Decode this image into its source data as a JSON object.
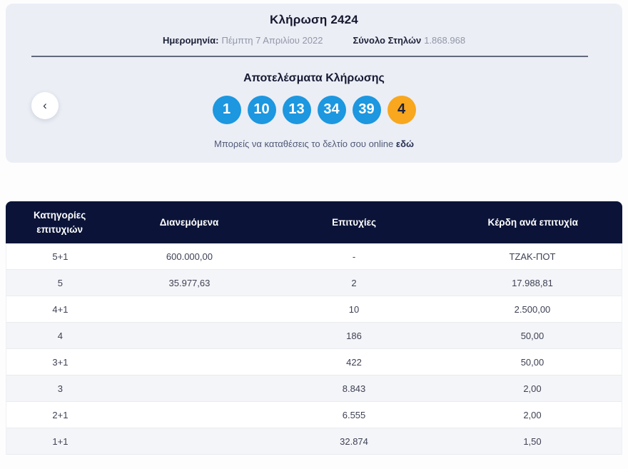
{
  "header": {
    "title": "Κλήρωση 2424",
    "date_label": "Ημερομηνία:",
    "date_value": "Πέμπτη 7 Απριλίου 2022",
    "total_label": "Σύνολο Στηλών",
    "total_value": "1.868.968"
  },
  "nav": {
    "back_icon": "‹"
  },
  "results": {
    "title": "Αποτελέσματα Κλήρωσης",
    "numbers": [
      "1",
      "10",
      "13",
      "34",
      "39"
    ],
    "bonus": "4",
    "note_text": "Μπορείς να καταθέσεις το δελτίο σου online",
    "note_link_label": "εδώ"
  },
  "table": {
    "headers": [
      "Κατηγορίες επιτυχιών",
      "Διανεμόμενα",
      "Επιτυχίες",
      "Κέρδη ανά επιτυχία"
    ],
    "rows": [
      [
        "5+1",
        "600.000,00",
        "-",
        "ΤΖΑΚ-ΠΟΤ"
      ],
      [
        "5",
        "35.977,63",
        "2",
        "17.988,81"
      ],
      [
        "4+1",
        "",
        "10",
        "2.500,00"
      ],
      [
        "4",
        "",
        "186",
        "50,00"
      ],
      [
        "3+1",
        "",
        "422",
        "50,00"
      ],
      [
        "3",
        "",
        "8.843",
        "2,00"
      ],
      [
        "2+1",
        "",
        "6.555",
        "2,00"
      ],
      [
        "1+1",
        "",
        "32.874",
        "1,50"
      ]
    ]
  },
  "colors": {
    "ball_blue": "#1c97e0",
    "ball_bonus_orange": "#f8a71e",
    "table_header_navy": "#0b1438"
  }
}
